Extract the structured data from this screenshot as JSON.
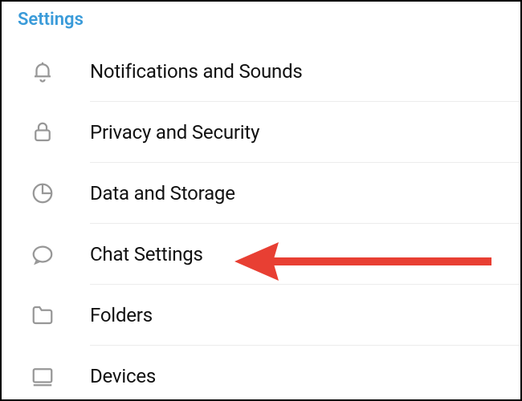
{
  "header": {
    "title": "Settings"
  },
  "items": [
    {
      "label": "Notifications and Sounds",
      "icon": "bell-icon"
    },
    {
      "label": "Privacy and Security",
      "icon": "lock-icon"
    },
    {
      "label": "Data and Storage",
      "icon": "pie-icon"
    },
    {
      "label": "Chat Settings",
      "icon": "chat-icon"
    },
    {
      "label": "Folders",
      "icon": "folder-icon"
    },
    {
      "label": "Devices",
      "icon": "devices-icon"
    }
  ],
  "annotation": {
    "arrow_target_index": 3,
    "arrow_color": "#e83f33"
  }
}
